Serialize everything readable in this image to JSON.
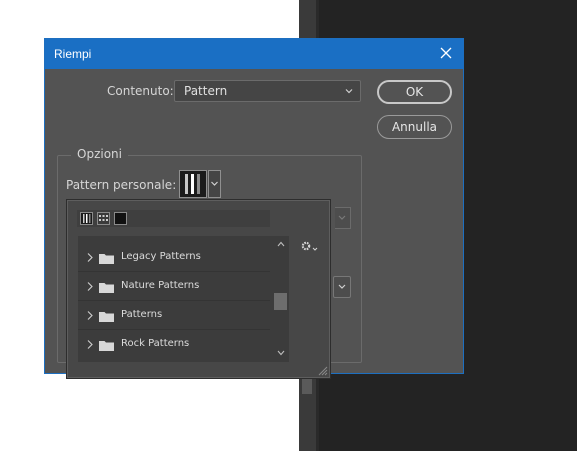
{
  "dialog": {
    "title": "Riempi",
    "content_label": "Contenuto:",
    "content_value": "Pattern",
    "ok_label": "OK",
    "cancel_label": "Annulla",
    "options_group_label": "Opzioni",
    "custom_pattern_label": "Pattern personale:"
  },
  "picker": {
    "items": [
      {
        "label": "Legacy Patterns",
        "icon": "folder-icon"
      },
      {
        "label": "Nature Patterns",
        "icon": "folder-icon"
      },
      {
        "label": "Patterns",
        "icon": "folder-icon"
      },
      {
        "label": "Rock Patterns",
        "icon": "folder-icon"
      }
    ],
    "settings_icon": "gear-icon"
  },
  "colors": {
    "titlebar": "#1a6fc4",
    "dialog_bg": "#535353",
    "app_dark": "#232323"
  }
}
